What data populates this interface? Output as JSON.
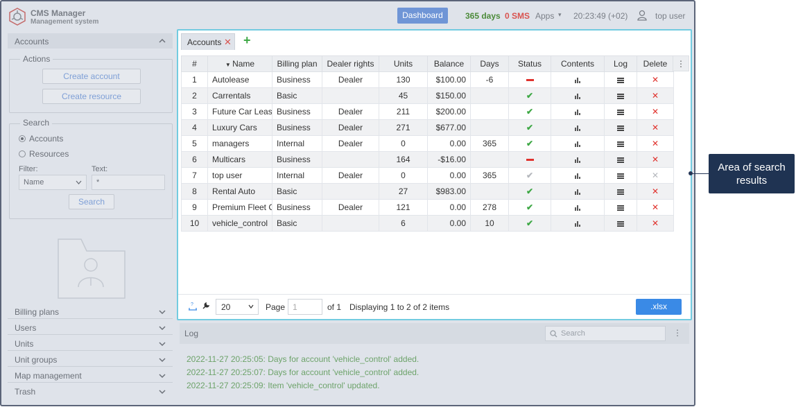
{
  "app": {
    "title": "CMS Manager",
    "subtitle": "Management system"
  },
  "header": {
    "dashboard_label": "Dashboard",
    "days": "365 days",
    "sms": "0 SMS",
    "apps": "Apps",
    "time": "20:23:49 (+02)",
    "user": "top user"
  },
  "sidebar": {
    "accounts_title": "Accounts",
    "actions_title": "Actions",
    "create_account": "Create account",
    "create_resource": "Create resource",
    "search_title": "Search",
    "radio_accounts": "Accounts",
    "radio_resources": "Resources",
    "filter_label": "Filter:",
    "text_label": "Text:",
    "filter_value": "Name",
    "text_value": "*",
    "search_button": "Search",
    "sections": [
      "Billing plans",
      "Users",
      "Units",
      "Unit groups",
      "Map management",
      "Trash"
    ]
  },
  "panel": {
    "tab_label": "Accounts",
    "columns": [
      "#",
      "Name",
      "Billing plan",
      "Dealer rights",
      "Units",
      "Balance",
      "Days",
      "Status",
      "Contents",
      "Log",
      "Delete"
    ],
    "rows": [
      {
        "n": "1",
        "name": "Autolease",
        "plan": "Business",
        "dealer": "Dealer",
        "units": "130",
        "balance": "$100.00",
        "days": "-6",
        "status": "blocked",
        "deletable": true
      },
      {
        "n": "2",
        "name": "Carrentals",
        "plan": "Basic",
        "dealer": "",
        "units": "45",
        "balance": "$150.00",
        "days": "",
        "status": "active",
        "deletable": true
      },
      {
        "n": "3",
        "name": "Future Car Lease",
        "plan": "Business",
        "dealer": "Dealer",
        "units": "211",
        "balance": "$200.00",
        "days": "",
        "status": "active",
        "deletable": true
      },
      {
        "n": "4",
        "name": "Luxury Cars",
        "plan": "Business",
        "dealer": "Dealer",
        "units": "271",
        "balance": "$677.00",
        "days": "",
        "status": "active",
        "deletable": true
      },
      {
        "n": "5",
        "name": "managers",
        "plan": "Internal",
        "dealer": "Dealer",
        "units": "0",
        "balance": "0.00",
        "days": "365",
        "status": "active",
        "deletable": true
      },
      {
        "n": "6",
        "name": "Multicars",
        "plan": "Business",
        "dealer": "",
        "units": "164",
        "balance": "-$16.00",
        "days": "",
        "status": "blocked",
        "deletable": true
      },
      {
        "n": "7",
        "name": "top user",
        "plan": "Internal",
        "dealer": "Dealer",
        "units": "0",
        "balance": "0.00",
        "days": "365",
        "status": "inactive",
        "deletable": false
      },
      {
        "n": "8",
        "name": "Rental Auto",
        "plan": "Basic",
        "dealer": "",
        "units": "27",
        "balance": "$983.00",
        "days": "",
        "status": "active",
        "deletable": true
      },
      {
        "n": "9",
        "name": "Premium Fleet Co",
        "plan": "Business",
        "dealer": "Dealer",
        "units": "121",
        "balance": "0.00",
        "days": "278",
        "status": "active",
        "deletable": true
      },
      {
        "n": "10",
        "name": "vehicle_control",
        "plan": "Basic",
        "dealer": "",
        "units": "6",
        "balance": "0.00",
        "days": "10",
        "status": "active",
        "deletable": true
      }
    ],
    "page_size": "20",
    "page_label": "Page",
    "page_value": "1",
    "of_label": "of 1",
    "displaying": "Displaying 1 to 2 of 2 items",
    "xlsx_label": ".xlsx"
  },
  "log": {
    "title": "Log",
    "search_placeholder": "Search",
    "lines": [
      "2022-11-27 20:25:05: Days for account 'vehicle_control' added.",
      "2022-11-27 20:25:07: Days for account 'vehicle_control' added.",
      "2022-11-27 20:25:09: Item 'vehicle_control' updated."
    ]
  },
  "callout": {
    "line1": "Area of search",
    "line2": "results"
  }
}
